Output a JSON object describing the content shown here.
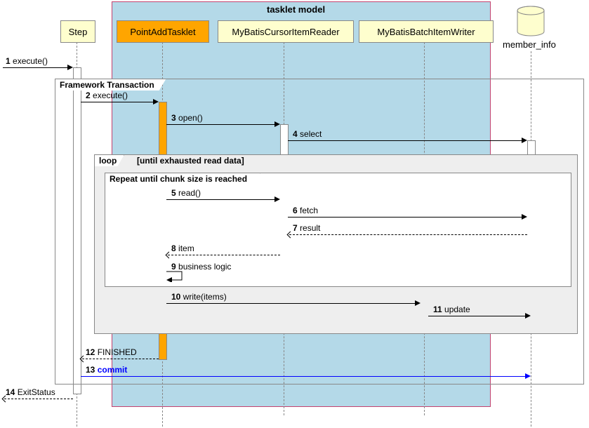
{
  "box": {
    "title": "tasklet model"
  },
  "participants": {
    "step": "Step",
    "tasklet": "PointAddTasklet",
    "reader": "MyBatisCursorItemReader",
    "writer": "MyBatisBatchItemWriter",
    "db": "member_info"
  },
  "fragments": {
    "tx": "Framework Transaction",
    "loop": "loop",
    "loop_guard": "[until exhausted read data]",
    "chunk": "Repeat until chunk size is reached"
  },
  "messages": {
    "m1": {
      "n": "1",
      "t": "execute()"
    },
    "m2": {
      "n": "2",
      "t": "execute()"
    },
    "m3": {
      "n": "3",
      "t": "open()"
    },
    "m4": {
      "n": "4",
      "t": "select"
    },
    "m5": {
      "n": "5",
      "t": "read()"
    },
    "m6": {
      "n": "6",
      "t": "fetch"
    },
    "m7": {
      "n": "7",
      "t": "result"
    },
    "m8": {
      "n": "8",
      "t": "item"
    },
    "m9": {
      "n": "9",
      "t": "business logic"
    },
    "m10": {
      "n": "10",
      "t": "write(items)"
    },
    "m11": {
      "n": "11",
      "t": "update"
    },
    "m12": {
      "n": "12",
      "t": "FINISHED"
    },
    "m13": {
      "n": "13",
      "t": "commit"
    },
    "m14": {
      "n": "14",
      "t": "ExitStatus"
    }
  },
  "chart_data": {
    "type": "sequence-diagram",
    "box": {
      "name": "tasklet model",
      "participants": [
        "PointAddTasklet",
        "MyBatisCursorItemReader",
        "MyBatisBatchItemWriter"
      ]
    },
    "participants": [
      {
        "id": "external",
        "type": "boundary"
      },
      {
        "id": "Step"
      },
      {
        "id": "PointAddTasklet"
      },
      {
        "id": "MyBatisCursorItemReader"
      },
      {
        "id": "MyBatisBatchItemWriter"
      },
      {
        "id": "member_info",
        "type": "database"
      }
    ],
    "interactions": [
      {
        "n": 1,
        "from": "external",
        "to": "Step",
        "label": "execute()"
      },
      {
        "fragment": "Framework Transaction",
        "children": [
          {
            "n": 2,
            "from": "Step",
            "to": "PointAddTasklet",
            "label": "execute()"
          },
          {
            "n": 3,
            "from": "PointAddTasklet",
            "to": "MyBatisCursorItemReader",
            "label": "open()"
          },
          {
            "n": 4,
            "from": "MyBatisCursorItemReader",
            "to": "member_info",
            "label": "select"
          },
          {
            "fragment": "loop",
            "guard": "[until exhausted read data]",
            "children": [
              {
                "fragment": "Repeat until chunk size is reached",
                "children": [
                  {
                    "n": 5,
                    "from": "PointAddTasklet",
                    "to": "MyBatisCursorItemReader",
                    "label": "read()"
                  },
                  {
                    "n": 6,
                    "from": "MyBatisCursorItemReader",
                    "to": "member_info",
                    "label": "fetch"
                  },
                  {
                    "n": 7,
                    "from": "member_info",
                    "to": "MyBatisCursorItemReader",
                    "label": "result",
                    "return": true
                  },
                  {
                    "n": 8,
                    "from": "MyBatisCursorItemReader",
                    "to": "PointAddTasklet",
                    "label": "item",
                    "return": true
                  },
                  {
                    "n": 9,
                    "from": "PointAddTasklet",
                    "to": "PointAddTasklet",
                    "label": "business logic"
                  }
                ]
              },
              {
                "n": 10,
                "from": "PointAddTasklet",
                "to": "MyBatisBatchItemWriter",
                "label": "write(items)"
              },
              {
                "n": 11,
                "from": "MyBatisBatchItemWriter",
                "to": "member_info",
                "label": "update"
              }
            ]
          },
          {
            "n": 12,
            "from": "PointAddTasklet",
            "to": "Step",
            "label": "FINISHED",
            "return": true
          },
          {
            "n": 13,
            "from": "Step",
            "to": "member_info",
            "label": "commit",
            "color": "blue"
          }
        ]
      },
      {
        "n": 14,
        "from": "Step",
        "to": "external",
        "label": "ExitStatus",
        "return": true
      }
    ]
  }
}
